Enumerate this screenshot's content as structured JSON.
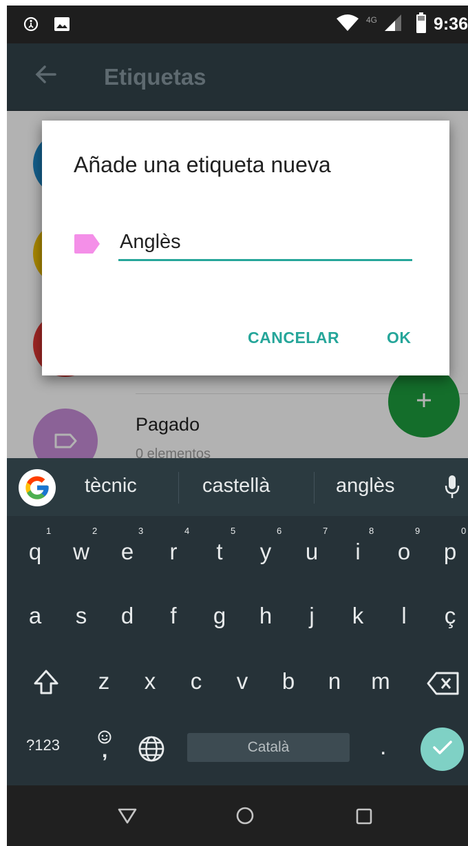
{
  "status_bar": {
    "network_label": "4G",
    "time": "9:36"
  },
  "app_bar": {
    "title": "Etiquetas"
  },
  "list": {
    "visible_item": {
      "title": "Pagado",
      "subtitle": "0 elementos"
    }
  },
  "dialog": {
    "title": "Añade una etiqueta nueva",
    "input_value": "Anglès",
    "tag_color": "#f48fe8",
    "accent_color": "#26a69a",
    "cancel_label": "CANCELAR",
    "ok_label": "OK"
  },
  "keyboard": {
    "suggestions": [
      "tècnic",
      "castellà",
      "anglès"
    ],
    "row1": [
      "q",
      "w",
      "e",
      "r",
      "t",
      "y",
      "u",
      "i",
      "o",
      "p"
    ],
    "row1_hints": [
      "1",
      "2",
      "3",
      "4",
      "5",
      "6",
      "7",
      "8",
      "9",
      "0"
    ],
    "row2": [
      "a",
      "s",
      "d",
      "f",
      "g",
      "h",
      "j",
      "k",
      "l",
      "ç"
    ],
    "row3": [
      "z",
      "x",
      "c",
      "v",
      "b",
      "n",
      "m"
    ],
    "symbols_label": "?123",
    "comma_label": ",",
    "period_label": ".",
    "space_label": "Català"
  }
}
